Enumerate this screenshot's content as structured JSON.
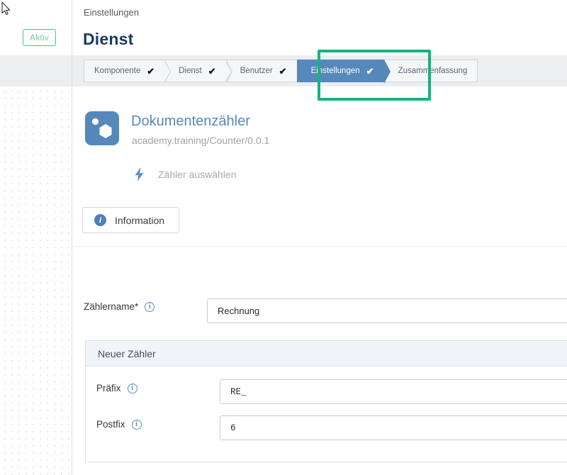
{
  "left_panel": {
    "status_badge": "Aktiv",
    "cursor_icon": "mouse-pointer-icon"
  },
  "header": {
    "breadcrumb": "Einstellungen",
    "title": "Dienst"
  },
  "wizard": {
    "steps": [
      {
        "label": "Komponente",
        "state": "done",
        "check": "✔"
      },
      {
        "label": "Dienst",
        "state": "done",
        "check": "✔"
      },
      {
        "label": "Benutzer",
        "state": "done",
        "check": "✔"
      },
      {
        "label": "Einstellungen",
        "state": "active",
        "check": "✔"
      },
      {
        "label": "Zusammenfassung",
        "state": "pending",
        "check": ""
      }
    ],
    "highlight_color": "#15b37e",
    "active_color": "#5588bb"
  },
  "component": {
    "icon": "component-hexagon-icon",
    "title": "Dokumentenzähler",
    "subtitle": "academy.training/Counter/0.0.1",
    "pick_icon": "lightning-bolt-icon",
    "pick_label": "Zähler auswählen",
    "info_button": "Information",
    "info_icon": "info-circle-icon"
  },
  "form": {
    "counter_name": {
      "label": "Zählername",
      "required_marker": "*",
      "info_icon": "info-circle-icon",
      "value": "Rechnung",
      "placeholder": ""
    },
    "panel": {
      "title": "Neuer Zähler",
      "fields": [
        {
          "label": "Präfix",
          "info_icon": "info-circle-icon",
          "value": "RE_",
          "placeholder": ""
        },
        {
          "label": "Postfix",
          "info_icon": "info-circle-icon",
          "value": "6",
          "placeholder": ""
        }
      ]
    }
  }
}
